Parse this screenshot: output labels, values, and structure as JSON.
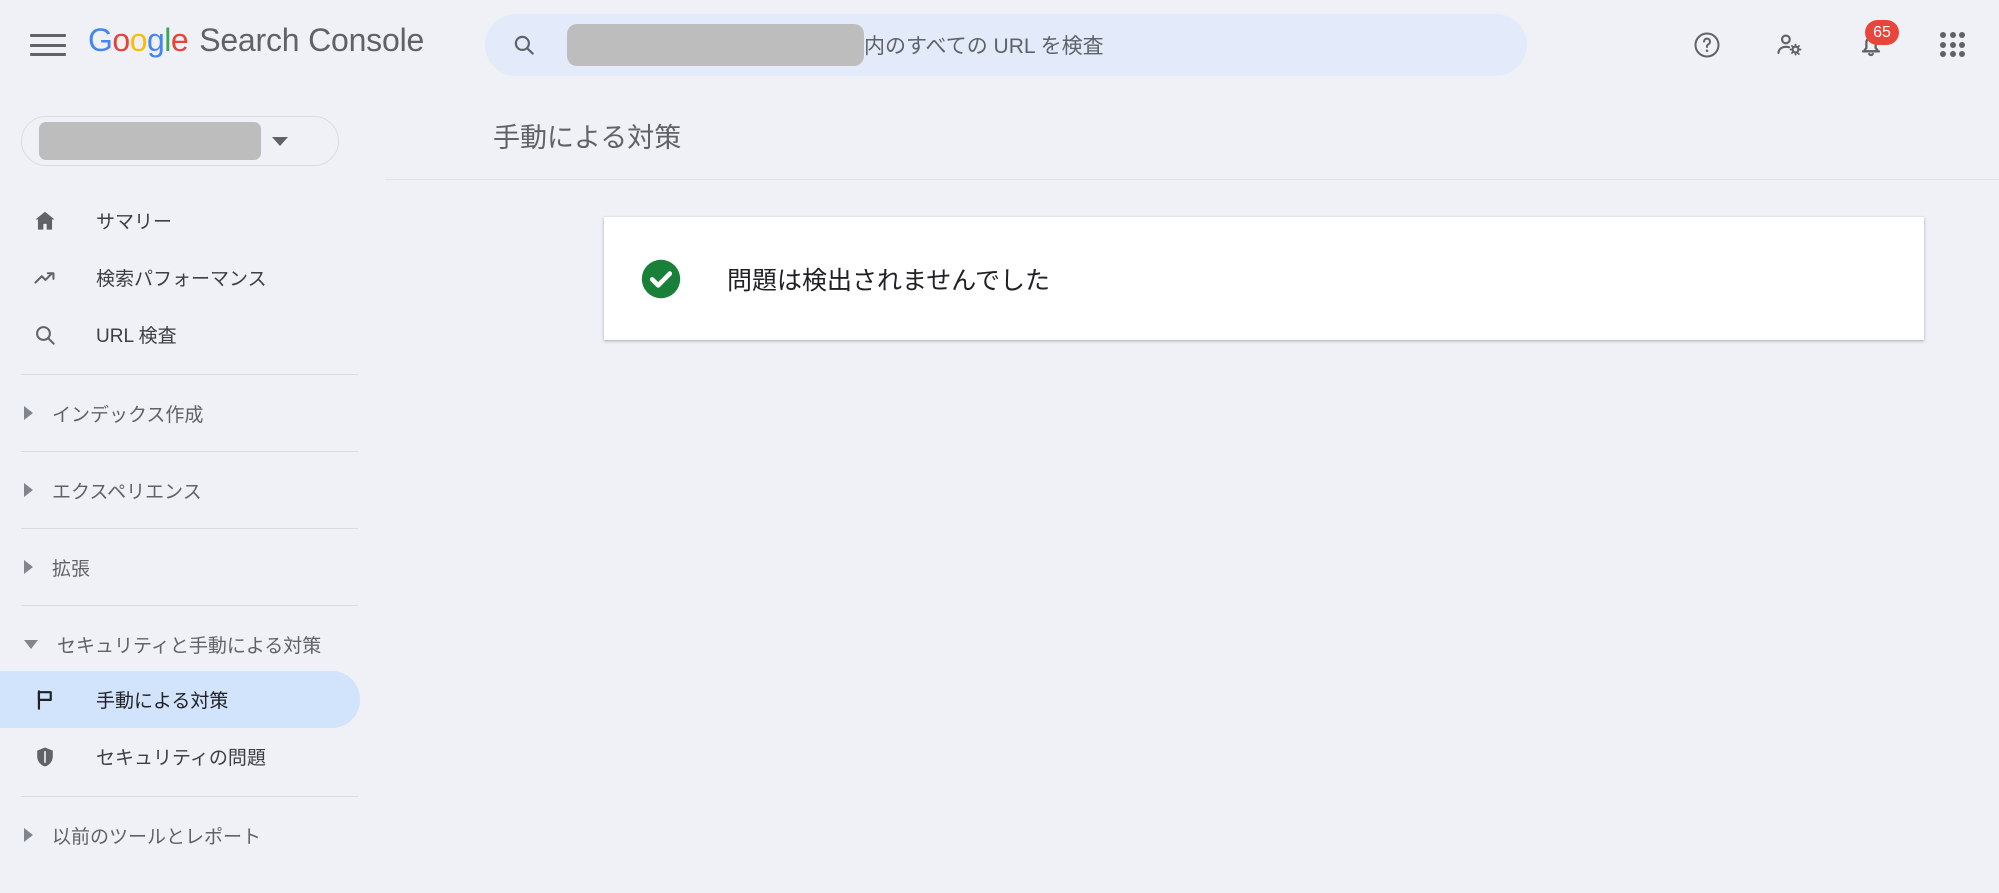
{
  "app": {
    "brand_google": "Google",
    "brand_product": "Search Console"
  },
  "topbar": {
    "menu_icon": "hamburger-menu-icon",
    "search": {
      "icon": "search-icon",
      "redacted_value": "",
      "placeholder_suffix": "内のすべての URL を検査"
    },
    "icons": [
      {
        "name": "help-icon",
        "label": "ヘルプ"
      },
      {
        "name": "account-settings-icon",
        "label": "アカウント設定"
      },
      {
        "name": "notifications-bell-icon",
        "label": "通知",
        "badge": "65"
      },
      {
        "name": "google-apps-grid-icon",
        "label": "Google アプリ"
      }
    ]
  },
  "sidebar": {
    "property_selector": {
      "redacted_value": "",
      "caret": "chevron-down-icon"
    },
    "items": [
      {
        "label": "サマリー",
        "icon": "home-icon",
        "active": false
      },
      {
        "label": "検索パフォーマンス",
        "icon": "trending-up-icon",
        "active": false
      },
      {
        "label": "URL 検査",
        "icon": "search-icon",
        "active": false
      }
    ],
    "sections": [
      {
        "label": "インデックス作成",
        "expanded": false
      },
      {
        "label": "エクスペリエンス",
        "expanded": false
      },
      {
        "label": "拡張",
        "expanded": false
      },
      {
        "label": "セキュリティと手動による対策",
        "expanded": true
      },
      {
        "label": "以前のツールとレポート",
        "expanded": false
      }
    ],
    "security_children": [
      {
        "label": "手動による対策",
        "icon": "flag-icon",
        "active": true
      },
      {
        "label": "セキュリティの問題",
        "icon": "shield-icon",
        "active": false
      }
    ]
  },
  "main": {
    "title": "手動による対策",
    "status_card": {
      "icon": "check-circle-icon",
      "message": "問題は検出されませんでした"
    }
  },
  "colors": {
    "page_background": "#eff1f6",
    "search_background": "#e3ebfa",
    "active_item": "#d2e3fc",
    "success_green": "#188038",
    "badge_red": "#e8453c",
    "redaction_gray": "#bdbdbd",
    "card_white": "#ffffff"
  }
}
